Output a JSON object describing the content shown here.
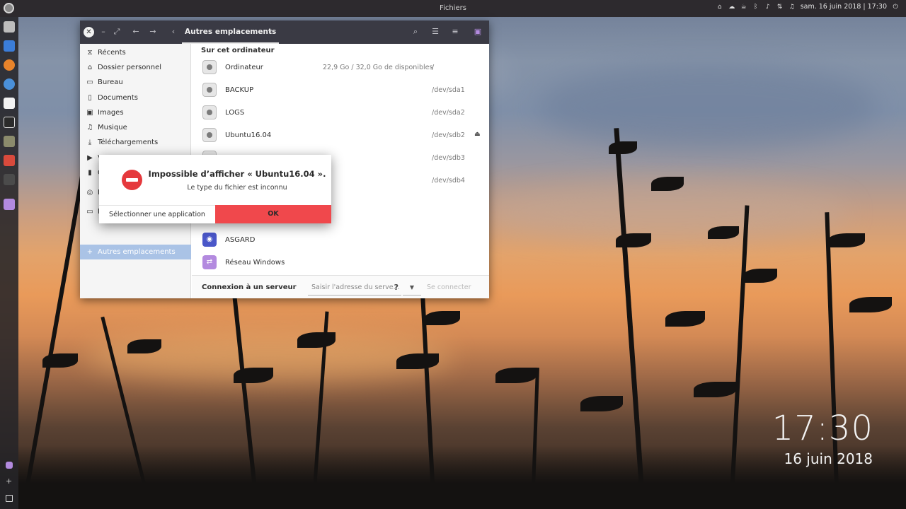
{
  "panel": {
    "title": "Fichiers",
    "datetime": "sam. 16 juin 2018 | 17:30",
    "icons": [
      "home-icon",
      "cloud-icon",
      "coffee-icon",
      "bluetooth-icon",
      "volume-icon",
      "network-icon",
      "bell-icon",
      "power-icon"
    ]
  },
  "launcher": {
    "items": [
      {
        "name": "files-icon",
        "color": "#c9c9c9"
      },
      {
        "name": "mail-icon",
        "color": "#3b7dd8"
      },
      {
        "name": "firefox-icon",
        "color": "#e8842b"
      },
      {
        "name": "chromium-icon",
        "color": "#4a90d9"
      },
      {
        "name": "document-icon",
        "color": "#f2f2f2"
      },
      {
        "name": "terminal-icon",
        "color": "#2b2b2b"
      },
      {
        "name": "disks-icon",
        "color": "#8b8b6c"
      },
      {
        "name": "monitor-icon",
        "color": "#d84a3c"
      },
      {
        "name": "console-icon",
        "color": "#4b4b4b"
      },
      {
        "name": "nautilus-icon",
        "color": "#b38adf"
      }
    ]
  },
  "clock": {
    "time": "17:30",
    "date": "16 juin 2018"
  },
  "window": {
    "location_tab": "Autres emplacements",
    "sidebar": [
      {
        "label": "Récents",
        "icon": "clock-icon",
        "glyph": "⧖"
      },
      {
        "label": "Dossier personnel",
        "icon": "home-icon",
        "glyph": "⌂"
      },
      {
        "label": "Bureau",
        "icon": "folder-icon",
        "glyph": "▭"
      },
      {
        "label": "Documents",
        "icon": "document-icon",
        "glyph": "▯"
      },
      {
        "label": "Images",
        "icon": "image-icon",
        "glyph": "▣"
      },
      {
        "label": "Musique",
        "icon": "music-icon",
        "glyph": "♫"
      },
      {
        "label": "Téléchargements",
        "icon": "download-icon",
        "glyph": "⤓"
      },
      {
        "label": "V",
        "icon": "video-icon",
        "glyph": "▶"
      },
      {
        "label": "C",
        "icon": "trash-icon",
        "glyph": "▮"
      },
      {
        "label": "R",
        "icon": "network-icon",
        "glyph": "◎"
      },
      {
        "label": "N",
        "icon": "folder-icon",
        "glyph": "▭"
      },
      {
        "label": "Autres emplacements",
        "icon": "plus-icon",
        "glyph": "+"
      }
    ],
    "section_title": "Sur cet ordinateur",
    "devices": [
      {
        "name": "Ordinateur",
        "info": "22,9 Go / 32,0 Go de disponibles",
        "dev": "/",
        "eject": ""
      },
      {
        "name": "BACKUP",
        "info": "",
        "dev": "/dev/sda1",
        "eject": ""
      },
      {
        "name": "LOGS",
        "info": "",
        "dev": "/dev/sda2",
        "eject": ""
      },
      {
        "name": "Ubuntu16.04",
        "info": "",
        "dev": "/dev/sdb2",
        "eject": "⏏"
      },
      {
        "name": "",
        "info": "",
        "dev": "/dev/sdb3",
        "eject": ""
      },
      {
        "name": "",
        "info": "",
        "dev": "/dev/sdb4",
        "eject": ""
      }
    ],
    "networks": [
      {
        "name": "ASGARD",
        "icon": "wifi-icon"
      },
      {
        "name": "Réseau Windows",
        "icon": "network-share-icon"
      }
    ],
    "connect": {
      "label": "Connexion à un serveur",
      "placeholder": "Saisir l'adresse du serve...",
      "help": "?",
      "button": "Se connecter"
    }
  },
  "dialog": {
    "title": "Impossible d’afficher « Ubuntu16.04 ».",
    "message": "Le type du fichier est inconnu",
    "select_app": "Sélectionner une application",
    "ok": "OK"
  }
}
